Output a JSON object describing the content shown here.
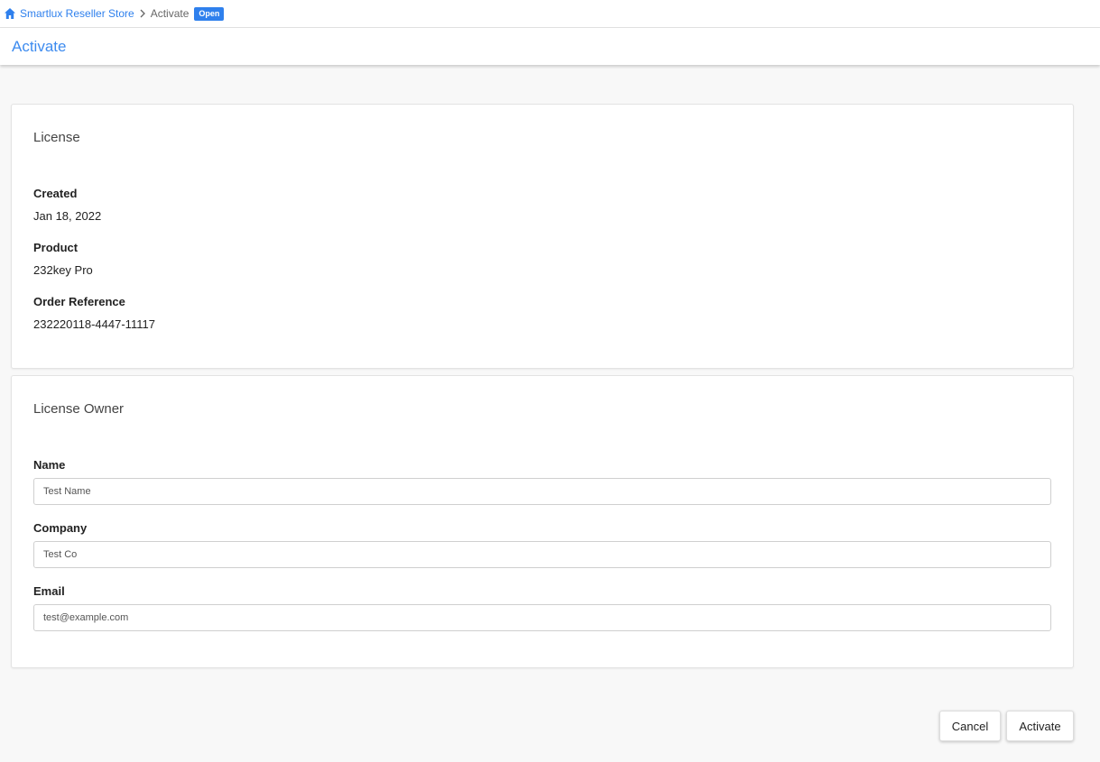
{
  "breadcrumb": {
    "home_icon": "home-icon",
    "store_label": "Smartlux Reseller Store",
    "separator_icon": "chevron-right-icon",
    "current_label": "Activate",
    "status_badge": "Open"
  },
  "header": {
    "title": "Activate"
  },
  "license": {
    "title": "License",
    "created_label": "Created",
    "created_value": "Jan 18, 2022",
    "product_label": "Product",
    "product_value": "232key Pro",
    "order_label": "Order Reference",
    "order_value": "232220118-4447-11117"
  },
  "owner": {
    "title": "License Owner",
    "name_label": "Name",
    "name_value": "Test Name",
    "company_label": "Company",
    "company_value": "Test Co",
    "email_label": "Email",
    "email_value": "test@example.com"
  },
  "actions": {
    "cancel_label": "Cancel",
    "activate_label": "Activate"
  },
  "colors": {
    "accent": "#2f80ed",
    "title_blue": "#3d8bef",
    "background": "#f8f8f8"
  }
}
